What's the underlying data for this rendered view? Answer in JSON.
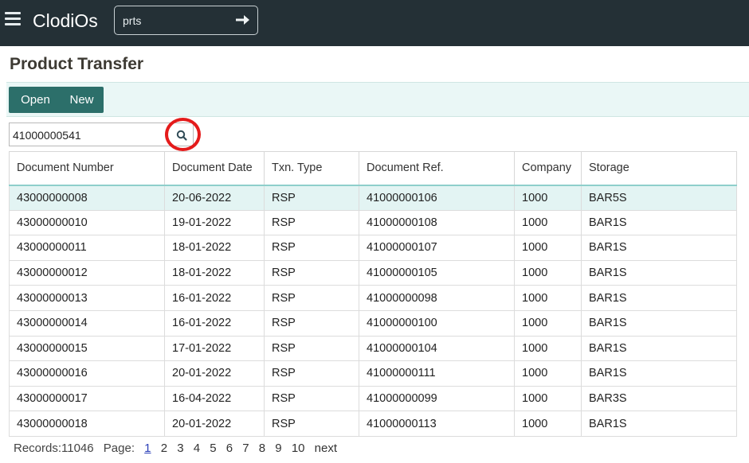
{
  "app": {
    "brand": "ClodiOs",
    "menu_icon": "hamburger-menu-icon",
    "go_icon": "arrow-right-icon"
  },
  "topsearch": {
    "value": "prts"
  },
  "page": {
    "title": "Product Transfer"
  },
  "toolbar": {
    "open_label": "Open",
    "new_label": "New"
  },
  "filter": {
    "value": "41000000541",
    "search_icon": "search-icon"
  },
  "colors": {
    "topbar": "#243036",
    "accent": "#2c6f6a",
    "highlight": "#e41b1b"
  },
  "table": {
    "columns": [
      "Document Number",
      "Document Date",
      "Txn. Type",
      "Document Ref.",
      "Company",
      "Storage"
    ],
    "rows": [
      [
        "43000000008",
        "20-06-2022",
        "RSP",
        "41000000106",
        "1000",
        "BAR5S"
      ],
      [
        "43000000010",
        "19-01-2022",
        "RSP",
        "41000000108",
        "1000",
        "BAR1S"
      ],
      [
        "43000000011",
        "18-01-2022",
        "RSP",
        "41000000107",
        "1000",
        "BAR1S"
      ],
      [
        "43000000012",
        "18-01-2022",
        "RSP",
        "41000000105",
        "1000",
        "BAR1S"
      ],
      [
        "43000000013",
        "16-01-2022",
        "RSP",
        "41000000098",
        "1000",
        "BAR1S"
      ],
      [
        "43000000014",
        "16-01-2022",
        "RSP",
        "41000000100",
        "1000",
        "BAR1S"
      ],
      [
        "43000000015",
        "17-01-2022",
        "RSP",
        "41000000104",
        "1000",
        "BAR1S"
      ],
      [
        "43000000016",
        "20-01-2022",
        "RSP",
        "41000000111",
        "1000",
        "BAR1S"
      ],
      [
        "43000000017",
        "16-04-2022",
        "RSP",
        "41000000099",
        "1000",
        "BAR3S"
      ],
      [
        "43000000018",
        "20-01-2022",
        "RSP",
        "41000000113",
        "1000",
        "BAR1S"
      ]
    ]
  },
  "pager": {
    "records_label": "Records:11046",
    "page_label": "Page:",
    "pages": [
      "1",
      "2",
      "3",
      "4",
      "5",
      "6",
      "7",
      "8",
      "9",
      "10"
    ],
    "current": "1",
    "next_label": "next"
  }
}
